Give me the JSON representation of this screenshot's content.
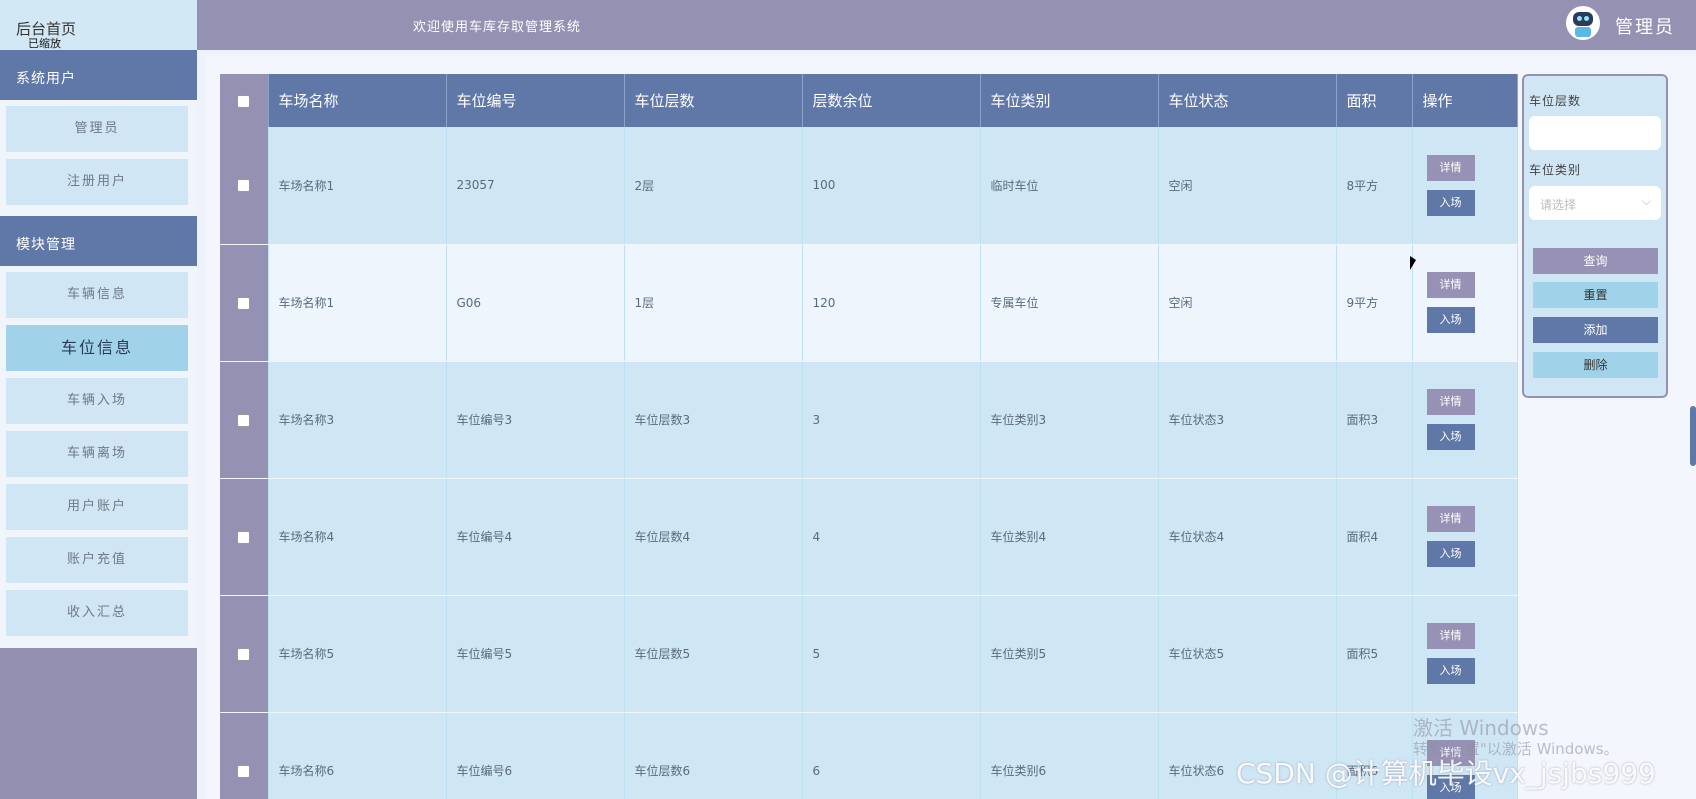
{
  "sidebar": {
    "logo_text": "后台首页",
    "logo_sub": "已缩放",
    "groups": [
      {
        "title": "系统用户",
        "items": [
          "管理员",
          "注册用户"
        ]
      },
      {
        "title": "模块管理",
        "items": [
          "车辆信息",
          "车位信息",
          "车辆入场",
          "车辆离场",
          "用户账户",
          "账户充值",
          "收入汇总"
        ]
      }
    ],
    "active_item": "车位信息"
  },
  "header": {
    "welcome": "欢迎使用车库存取管理系统",
    "admin": "管理员"
  },
  "table": {
    "columns": [
      "车场名称",
      "车位编号",
      "车位层数",
      "层数余位",
      "车位类别",
      "车位状态",
      "面积",
      "操作"
    ],
    "rows": [
      [
        "车场名称1",
        "23057",
        "2层",
        "100",
        "临时车位",
        "空闲",
        "8平方"
      ],
      [
        "车场名称1",
        "G06",
        "1层",
        "120",
        "专属车位",
        "空闲",
        "9平方"
      ],
      [
        "车场名称3",
        "车位编号3",
        "车位层数3",
        "3",
        "车位类别3",
        "车位状态3",
        "面积3"
      ],
      [
        "车场名称4",
        "车位编号4",
        "车位层数4",
        "4",
        "车位类别4",
        "车位状态4",
        "面积4"
      ],
      [
        "车场名称5",
        "车位编号5",
        "车位层数5",
        "5",
        "车位类别5",
        "车位状态5",
        "面积5"
      ],
      [
        "车场名称6",
        "车位编号6",
        "车位层数6",
        "6",
        "车位类别6",
        "车位状态6",
        "面积6"
      ]
    ],
    "detail_label": "详情",
    "enter_label": "入场"
  },
  "filter": {
    "floor_label": "车位层数",
    "floor_value": "",
    "type_label": "车位类别",
    "type_placeholder": "请选择",
    "query_label": "查询",
    "reset_label": "重置",
    "add_label": "添加",
    "delete_label": "删除"
  },
  "colors": {
    "header_bg": "#5f78a7",
    "side_bg": "#9591b3",
    "row_odd": "#cfe6f4",
    "row_even": "#eef5fd",
    "reset_btn": "#9fd3ea",
    "delete_btn": "#a0d2e9"
  },
  "watermark": {
    "windows_title": "激活 Windows",
    "windows_sub": "转到\"设置\"以激活 Windows。",
    "csdn": "CSDN @计算机毕设vx_jsjbs999"
  }
}
